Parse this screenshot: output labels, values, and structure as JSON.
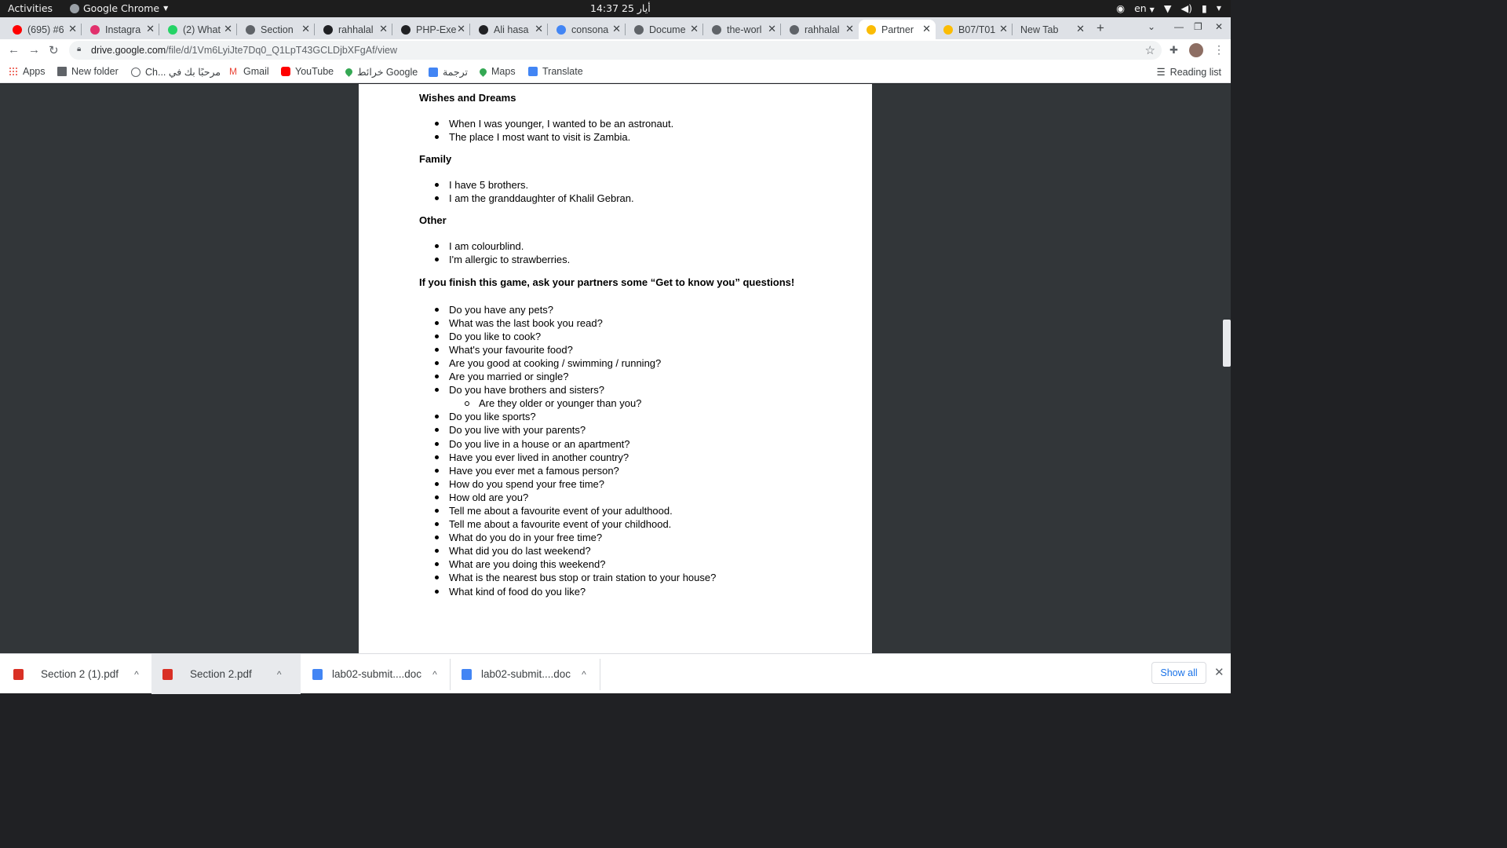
{
  "system_bar": {
    "activities": "Activities",
    "app_name": "Google Chrome",
    "clock": "14:37  25 أيار",
    "lang": "en"
  },
  "tabs": [
    {
      "title": "(695) #6",
      "favicon_color": "#ff0000",
      "icon": "youtube-icon"
    },
    {
      "title": "Instagra",
      "favicon_color": "#e1306c",
      "icon": "instagram-icon"
    },
    {
      "title": "(2) What",
      "favicon_color": "#25d366",
      "icon": "whatsapp-icon"
    },
    {
      "title": "Section",
      "favicon_color": "#5f6368",
      "icon": "globe-icon"
    },
    {
      "title": "rahhalal",
      "favicon_color": "#202124",
      "icon": "github-icon"
    },
    {
      "title": "PHP-Exe",
      "favicon_color": "#202124",
      "icon": "github-icon"
    },
    {
      "title": "Ali hasa",
      "favicon_color": "#202124",
      "icon": "book-icon"
    },
    {
      "title": "consona",
      "favicon_color": "#4285f4",
      "icon": "google-icon"
    },
    {
      "title": "Docume",
      "favicon_color": "#5f6368",
      "icon": "globe-icon"
    },
    {
      "title": "the-worl",
      "favicon_color": "#5f6368",
      "icon": "globe-icon"
    },
    {
      "title": "rahhalal",
      "favicon_color": "#5f6368",
      "icon": "globe-icon"
    },
    {
      "title": "Partner",
      "favicon_color": "#fbbc04",
      "icon": "google-drive-icon",
      "active": true
    },
    {
      "title": "B07/T01",
      "favicon_color": "#fbbc04",
      "icon": "google-drive-icon"
    },
    {
      "title": "New Tab",
      "favicon_color": "",
      "icon": ""
    }
  ],
  "address_bar": {
    "host": "drive.google.com",
    "path": "/file/d/1Vm6LyiJte7Dq0_Q1LpT43GCLDjbXFgAf/view"
  },
  "bookmarks": {
    "apps": "Apps",
    "new_folder": "New folder",
    "marhaba": "Ch... مرحبًا بك في",
    "gmail": "Gmail",
    "youtube": "YouTube",
    "google_maps_ar": "خرائط Google",
    "translate_ar": "ترجمة",
    "maps": "Maps",
    "translate": "Translate",
    "reading_list": "Reading list"
  },
  "document": {
    "wishes": {
      "heading": "Wishes and Dreams",
      "items": [
        "When I was younger, I wanted to be an astronaut.",
        "The place I most want to visit is Zambia."
      ]
    },
    "family": {
      "heading": "Family",
      "items": [
        "I have 5 brothers.",
        "I am the granddaughter of Khalil Gebran."
      ]
    },
    "other": {
      "heading": "Other",
      "items": [
        "I am colourblind.",
        "I'm allergic to strawberries."
      ]
    },
    "questions": {
      "heading": "If you finish this game, ask your partners some “Get to know you” questions!",
      "items": [
        "Do you have any pets?",
        "What was the last book you read?",
        "Do you like to cook?",
        "What's your favourite food?",
        "Are you good at cooking / swimming / running?",
        "Are you married or single?",
        "Do you have brothers and sisters?",
        "Are they older or younger than you?",
        "Do you like sports?",
        "Do you live with your parents?",
        "Do you live in a house or an apartment?",
        "Have you ever lived in another country?",
        "Have you ever met a famous person?",
        "How do you spend your free time?",
        "How old are you?",
        "Tell me about a favourite event of your adulthood.",
        "Tell me about a favourite event of your childhood.",
        "What do you do in your free time?",
        "What did you do last weekend?",
        "What are you doing this weekend?",
        "What is the nearest bus stop or train station to your house?",
        "What kind of food do you like?"
      ]
    }
  },
  "downloads": {
    "items": [
      {
        "name": "Section 2 (1).pdf",
        "type": "pdf",
        "color": "#d93025"
      },
      {
        "name": "Section 2.pdf",
        "type": "pdf",
        "color": "#d93025"
      },
      {
        "name": "lab02-submit....doc",
        "type": "doc",
        "color": "#4285f4"
      },
      {
        "name": "lab02-submit....doc",
        "type": "doc",
        "color": "#4285f4"
      }
    ],
    "show_all": "Show all"
  }
}
